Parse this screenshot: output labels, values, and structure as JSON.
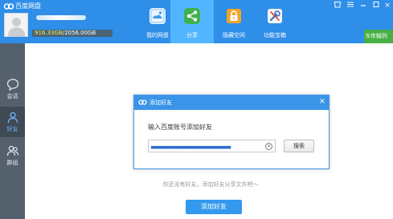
{
  "app": {
    "title": "百度网盘"
  },
  "window": {
    "close_glyph": "×"
  },
  "user": {
    "quota_used": "916.33GB",
    "quota_total": "/2056.00GB"
  },
  "nav": [
    {
      "label": "我的网盘",
      "icon": "drive-icon"
    },
    {
      "label": "分享",
      "icon": "share-icon"
    },
    {
      "label": "隐藏空间",
      "icon": "lock-icon"
    },
    {
      "label": "功能宝箱",
      "icon": "tools-icon"
    }
  ],
  "transfer": {
    "label": "传输列"
  },
  "sidebar": [
    {
      "label": "会话",
      "icon": "chat-icon"
    },
    {
      "label": "好友",
      "icon": "friend-icon"
    },
    {
      "label": "群组",
      "icon": "group-icon"
    }
  ],
  "dialog": {
    "title": "添加好友",
    "close_glyph": "×",
    "prompt": "输入百度账号添加好友",
    "input_value": "▄▄▄▄▄▄▄▄▄▄▄▄▄▄▄▄▄▄▄▄▄▄▄▄",
    "clear_glyph": "×",
    "search_label": "搜索"
  },
  "main": {
    "empty_text": "你还没有好友，添加好友分享文件吧～",
    "add_friend_label": "添加好友"
  },
  "colors": {
    "topbar": "#2e8ee8",
    "active_nav": "#52b5ff",
    "sidebar": "#54606b",
    "transfer": "#49b045",
    "quota_used": "#ffe84c"
  }
}
